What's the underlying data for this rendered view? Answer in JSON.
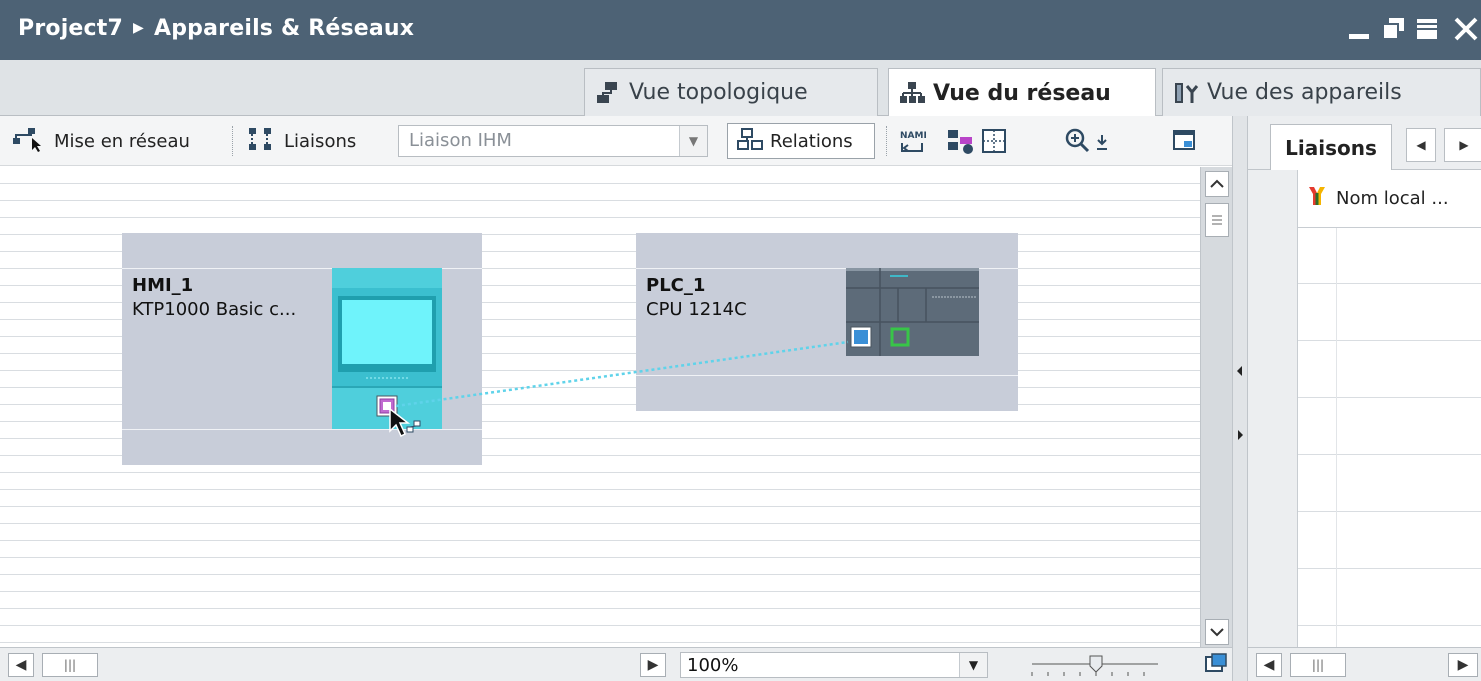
{
  "titlebar": {
    "project": "Project7",
    "section": "Appareils & Réseaux"
  },
  "tabs": [
    {
      "label": "Vue topologique",
      "icon": "topology-icon",
      "active": false
    },
    {
      "label": "Vue du réseau",
      "icon": "network-icon",
      "active": true
    },
    {
      "label": "Vue des appareils",
      "icon": "device-view-icon",
      "active": false
    }
  ],
  "toolbar": {
    "networking_label": "Mise en réseau",
    "connections_label": "Liaisons",
    "connection_type_value": "Liaison IHM",
    "relations_label": "Relations"
  },
  "devices": [
    {
      "name": "HMI_1",
      "type": "KTP1000 Basic c..."
    },
    {
      "name": "PLC_1",
      "type": "CPU 1214C"
    }
  ],
  "zoom": {
    "value": "100%"
  },
  "right_pane": {
    "tab_label": "Liaisons",
    "column_header": "Nom local ..."
  },
  "colors": {
    "titlebar": "#4d6275",
    "hmi_body": "#4fcfdc",
    "hmi_screen": "#6ff3fb",
    "plc_body": "#5d6b79",
    "device_box": "#c8cdd9",
    "connection_line": "#5fd3ea"
  }
}
